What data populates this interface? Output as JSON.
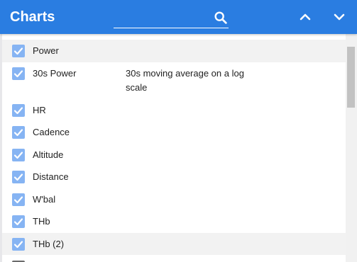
{
  "header": {
    "title": "Charts",
    "search_placeholder": "",
    "search_value": ""
  },
  "colors": {
    "header_bg": "#2a7de1",
    "checkbox_checked": "#86b4f3",
    "row_shaded": "#f2f2f2"
  },
  "icons": {
    "search": "search-icon",
    "up": "chevron-up-icon",
    "down": "chevron-down-icon",
    "check": "check-icon"
  },
  "items": [
    {
      "label": "Power",
      "description": "",
      "checked": true,
      "shaded": true
    },
    {
      "label": "30s Power",
      "description": "30s moving average on a log scale",
      "checked": true,
      "shaded": false
    },
    {
      "label": "HR",
      "description": "",
      "checked": true,
      "shaded": false
    },
    {
      "label": "Cadence",
      "description": "",
      "checked": true,
      "shaded": false
    },
    {
      "label": "Altitude",
      "description": "",
      "checked": true,
      "shaded": false
    },
    {
      "label": "Distance",
      "description": "",
      "checked": true,
      "shaded": false
    },
    {
      "label": "W'bal",
      "description": "",
      "checked": true,
      "shaded": false
    },
    {
      "label": "THb",
      "description": "",
      "checked": true,
      "shaded": false
    },
    {
      "label": "THb (2)",
      "description": "",
      "checked": true,
      "shaded": true
    },
    {
      "label": "",
      "description": "",
      "checked": false,
      "shaded": false
    }
  ]
}
